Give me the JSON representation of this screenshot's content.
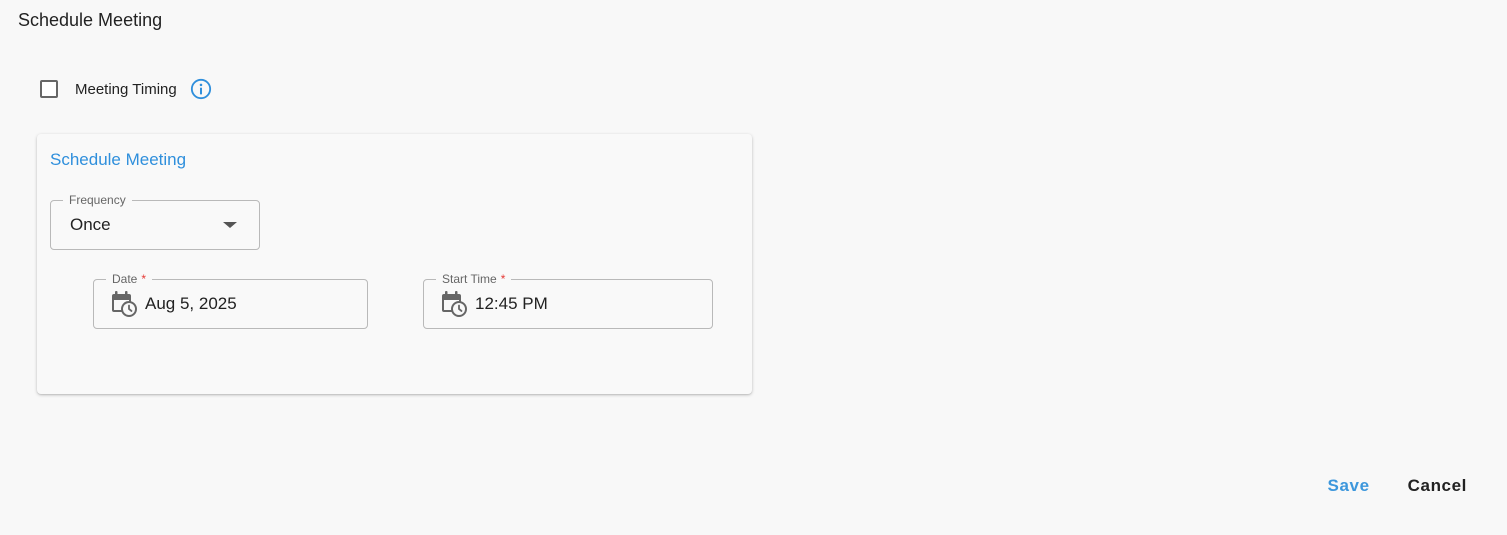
{
  "page": {
    "title": "Schedule Meeting"
  },
  "meeting_timing": {
    "label": "Meeting Timing",
    "checked": false,
    "info_icon": "info-icon"
  },
  "card": {
    "title": "Schedule Meeting",
    "frequency": {
      "label": "Frequency",
      "value": "Once"
    },
    "date": {
      "label": "Date",
      "required_mark": "*",
      "value": "Aug 5, 2025",
      "icon": "calendar-clock-icon"
    },
    "start_time": {
      "label": "Start Time",
      "required_mark": "*",
      "value": "12:45 PM",
      "icon": "calendar-clock-icon"
    }
  },
  "actions": {
    "save_label": "Save",
    "cancel_label": "Cancel"
  },
  "colors": {
    "accent": "#2f8fdc",
    "required": "#e53935",
    "background": "#f8f8f8"
  }
}
